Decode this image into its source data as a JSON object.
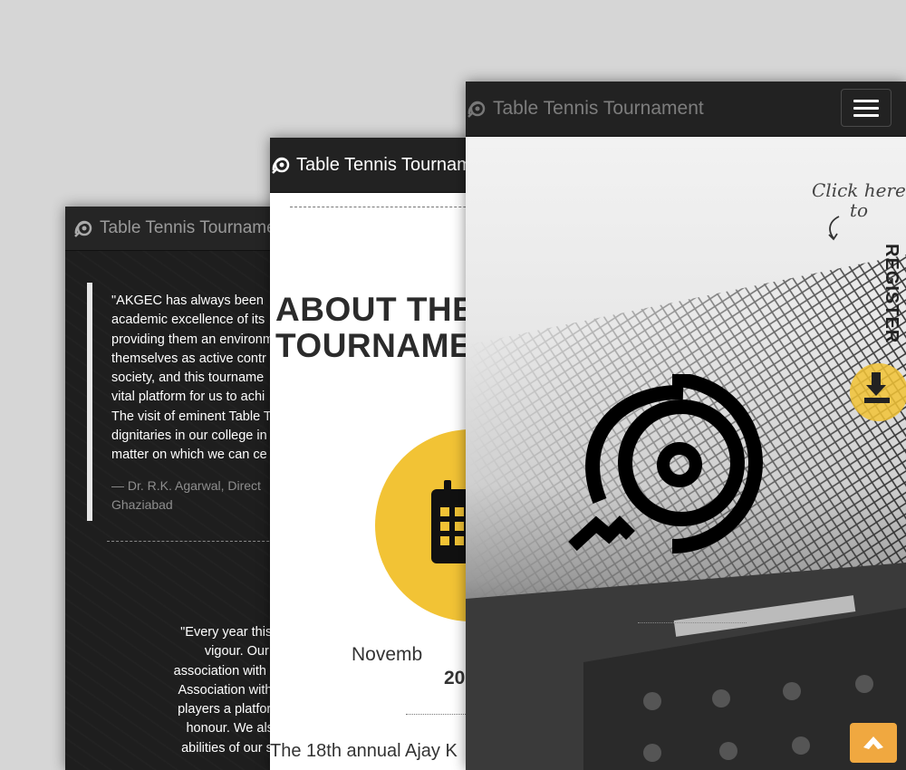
{
  "brand": {
    "name": "Table Tennis Tournament"
  },
  "screen1": {
    "quote1": {
      "lines": [
        "\"AKGEC has always been",
        "academic excellence of its",
        "providing them an environm",
        "themselves as active contr",
        "society, and this tourname",
        "vital platform for us to achi",
        "The visit of eminent Table T",
        "dignitaries in our college in",
        "matter on which we can ce"
      ],
      "citation_lines": [
        "— Dr. R.K. Agarwal, Direct",
        "Ghaziabad"
      ]
    },
    "quote2": {
      "lines": [
        "\"Every year this tournament i",
        "vigour. Our college c",
        "association with the Ghaziabad",
        "Association with a motive to p",
        "players a platform to showcas",
        "honour. We also feel proud",
        "abilities of our student conve"
      ]
    }
  },
  "screen2": {
    "about_title_lines": [
      "ABOUT THE",
      "TOURNAMEN"
    ],
    "date_month": "Novemb",
    "date_year": "20",
    "intro_text": "The 18th annual Ajay K"
  },
  "screen3": {
    "click_note_lines": [
      "Click here",
      "to"
    ],
    "register_label": "REGISTER",
    "icons": {
      "menu": "hamburger-icon",
      "download": "download-icon",
      "top": "chevron-up-icon",
      "logo": "table-tennis-logo"
    }
  },
  "colors": {
    "accent": "#f2c335",
    "navbar": "#222222",
    "top_button": "#f0a840"
  }
}
